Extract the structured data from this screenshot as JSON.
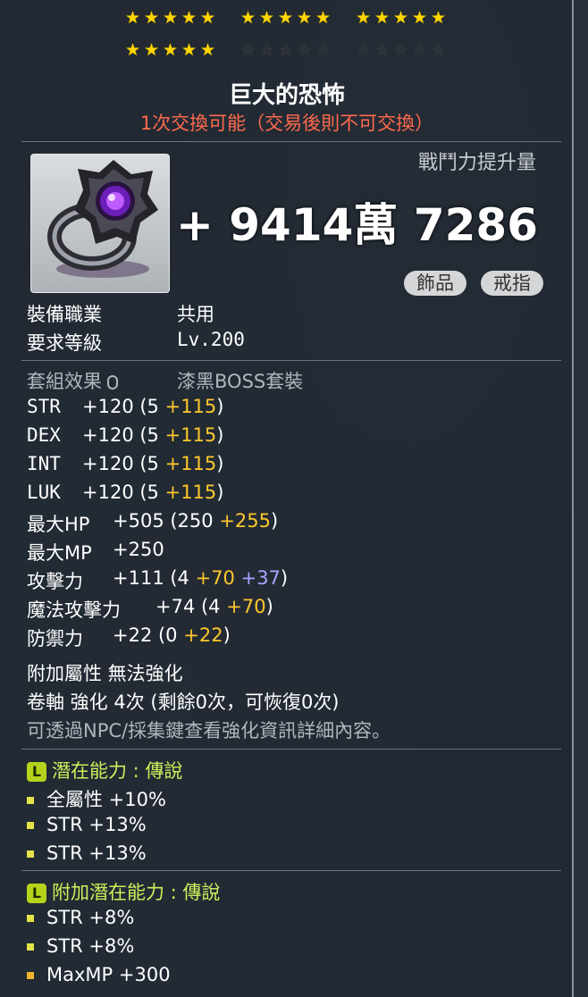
{
  "stars": {
    "row1_on": 15,
    "row2_on": 5,
    "row2_off": 10
  },
  "item": {
    "name": "巨大的恐怖",
    "trade": "1次交換可能（交易後則不可交換）",
    "combat_label": "戰鬥力提升量",
    "combat_value": "+ 9414萬 7286",
    "tags": [
      "飾品",
      "戒指"
    ]
  },
  "reqs": {
    "job_label": "裝備職業",
    "job_value": "共用",
    "level_label": "要求等級",
    "level_value": "Lv.200"
  },
  "set": {
    "label": "套組效果",
    "value": "漆黑BOSS套裝"
  },
  "stats": [
    {
      "name": "STR",
      "base": "+120 (5 ",
      "add": "+115",
      "end": ")"
    },
    {
      "name": "DEX",
      "base": "+120 (5 ",
      "add": "+115",
      "end": ")"
    },
    {
      "name": "INT",
      "base": "+120 (5 ",
      "add": "+115",
      "end": ")"
    },
    {
      "name": "LUK",
      "base": "+120 (5 ",
      "add": "+115",
      "end": ")"
    },
    {
      "name": "最大HP",
      "base": "+505 (250 ",
      "add": "+255",
      "end": ")"
    },
    {
      "name": "最大MP",
      "base": "+250",
      "add": "",
      "end": ""
    },
    {
      "name": "攻擊力",
      "base": "+111 (4 ",
      "add": "+70",
      "extra": " +37",
      "end": ")"
    },
    {
      "name": "魔法攻擊力",
      "base": "+74 (4 ",
      "add": "+70",
      "end": ")"
    },
    {
      "name": "防禦力",
      "base": "+22 (0 ",
      "add": "+22",
      "end": ")"
    }
  ],
  "enhance": {
    "extra_attr": "附加屬性 無法強化",
    "scroll": "卷軸 強化 4次 (剩餘0次，可恢復0次)",
    "hint": "可透過NPC/採集鍵查看強化資訊詳細內容。"
  },
  "potential": {
    "badge": "L",
    "title": "潛在能力 : 傳說",
    "lines": [
      "全屬性 +10%",
      "STR +13%",
      "STR +13%"
    ]
  },
  "bonus_potential": {
    "badge": "L",
    "title": "附加潛在能力 : 傳說",
    "lines": [
      "STR +8%",
      "STR +8%",
      "MaxMP +300"
    ]
  },
  "colors": {
    "potential_square": "#e3e34a",
    "bonus_square_last": "#f0b32a"
  }
}
